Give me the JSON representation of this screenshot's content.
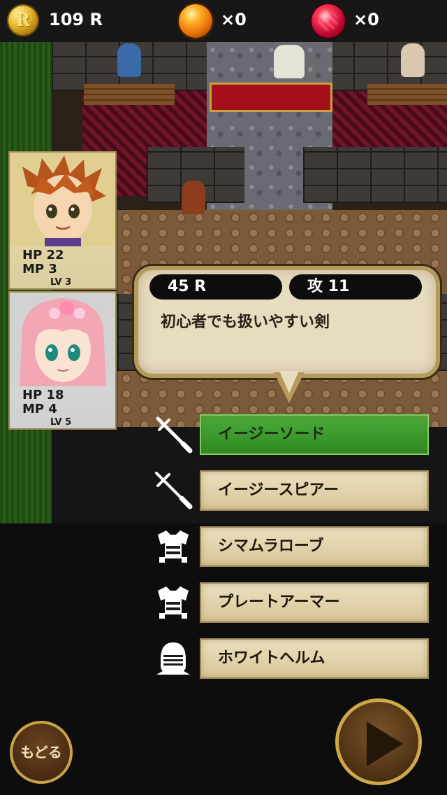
{
  "currency": {
    "coins_value": "109 R",
    "coin_glyph": "R",
    "orbs_value": "×0",
    "gems_value": "×0"
  },
  "party": [
    {
      "hp": "HP 22",
      "mp": "MP 3",
      "lv": "LV 3"
    },
    {
      "hp": "HP 18",
      "mp": "MP 4",
      "lv": "LV 5"
    }
  ],
  "item_info": {
    "price": "45 R",
    "attack": "攻 11",
    "description": "初心者でも扱いやすい剣"
  },
  "equipment": [
    {
      "label": "イージーソード",
      "icon": "sword-icon",
      "selected": true
    },
    {
      "label": "イージースピアー",
      "icon": "spear-icon",
      "selected": false
    },
    {
      "label": "シマムラローブ",
      "icon": "armor-icon",
      "selected": false
    },
    {
      "label": "プレートアーマー",
      "icon": "armor-icon",
      "selected": false
    },
    {
      "label": "ホワイトヘルム",
      "icon": "helmet-icon",
      "selected": false
    }
  ],
  "buttons": {
    "back_label": "もどる",
    "play_icon": "play-icon"
  },
  "colors": {
    "selected": "#3a9a2c",
    "panel": "#e3d6b4",
    "accent_gold": "#c7a24a"
  }
}
